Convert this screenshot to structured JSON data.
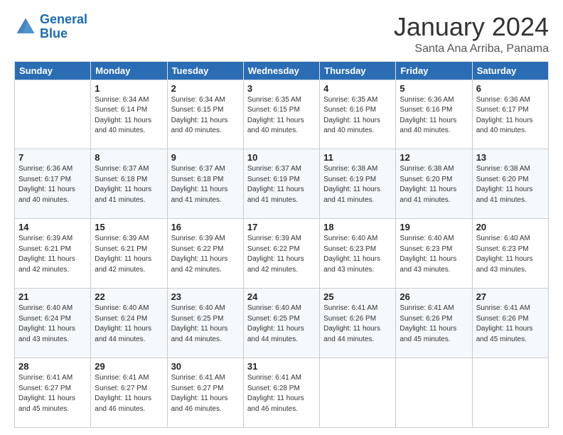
{
  "logo": {
    "line1": "General",
    "line2": "Blue"
  },
  "title": "January 2024",
  "subtitle": "Santa Ana Arriba, Panama",
  "weekdays": [
    "Sunday",
    "Monday",
    "Tuesday",
    "Wednesday",
    "Thursday",
    "Friday",
    "Saturday"
  ],
  "weeks": [
    [
      {
        "day": "",
        "sunrise": "",
        "sunset": "",
        "daylight": ""
      },
      {
        "day": "1",
        "sunrise": "Sunrise: 6:34 AM",
        "sunset": "Sunset: 6:14 PM",
        "daylight": "Daylight: 11 hours and 40 minutes."
      },
      {
        "day": "2",
        "sunrise": "Sunrise: 6:34 AM",
        "sunset": "Sunset: 6:15 PM",
        "daylight": "Daylight: 11 hours and 40 minutes."
      },
      {
        "day": "3",
        "sunrise": "Sunrise: 6:35 AM",
        "sunset": "Sunset: 6:15 PM",
        "daylight": "Daylight: 11 hours and 40 minutes."
      },
      {
        "day": "4",
        "sunrise": "Sunrise: 6:35 AM",
        "sunset": "Sunset: 6:16 PM",
        "daylight": "Daylight: 11 hours and 40 minutes."
      },
      {
        "day": "5",
        "sunrise": "Sunrise: 6:36 AM",
        "sunset": "Sunset: 6:16 PM",
        "daylight": "Daylight: 11 hours and 40 minutes."
      },
      {
        "day": "6",
        "sunrise": "Sunrise: 6:36 AM",
        "sunset": "Sunset: 6:17 PM",
        "daylight": "Daylight: 11 hours and 40 minutes."
      }
    ],
    [
      {
        "day": "7",
        "sunrise": "Sunrise: 6:36 AM",
        "sunset": "Sunset: 6:17 PM",
        "daylight": "Daylight: 11 hours and 40 minutes."
      },
      {
        "day": "8",
        "sunrise": "Sunrise: 6:37 AM",
        "sunset": "Sunset: 6:18 PM",
        "daylight": "Daylight: 11 hours and 41 minutes."
      },
      {
        "day": "9",
        "sunrise": "Sunrise: 6:37 AM",
        "sunset": "Sunset: 6:18 PM",
        "daylight": "Daylight: 11 hours and 41 minutes."
      },
      {
        "day": "10",
        "sunrise": "Sunrise: 6:37 AM",
        "sunset": "Sunset: 6:19 PM",
        "daylight": "Daylight: 11 hours and 41 minutes."
      },
      {
        "day": "11",
        "sunrise": "Sunrise: 6:38 AM",
        "sunset": "Sunset: 6:19 PM",
        "daylight": "Daylight: 11 hours and 41 minutes."
      },
      {
        "day": "12",
        "sunrise": "Sunrise: 6:38 AM",
        "sunset": "Sunset: 6:20 PM",
        "daylight": "Daylight: 11 hours and 41 minutes."
      },
      {
        "day": "13",
        "sunrise": "Sunrise: 6:38 AM",
        "sunset": "Sunset: 6:20 PM",
        "daylight": "Daylight: 11 hours and 41 minutes."
      }
    ],
    [
      {
        "day": "14",
        "sunrise": "Sunrise: 6:39 AM",
        "sunset": "Sunset: 6:21 PM",
        "daylight": "Daylight: 11 hours and 42 minutes."
      },
      {
        "day": "15",
        "sunrise": "Sunrise: 6:39 AM",
        "sunset": "Sunset: 6:21 PM",
        "daylight": "Daylight: 11 hours and 42 minutes."
      },
      {
        "day": "16",
        "sunrise": "Sunrise: 6:39 AM",
        "sunset": "Sunset: 6:22 PM",
        "daylight": "Daylight: 11 hours and 42 minutes."
      },
      {
        "day": "17",
        "sunrise": "Sunrise: 6:39 AM",
        "sunset": "Sunset: 6:22 PM",
        "daylight": "Daylight: 11 hours and 42 minutes."
      },
      {
        "day": "18",
        "sunrise": "Sunrise: 6:40 AM",
        "sunset": "Sunset: 6:23 PM",
        "daylight": "Daylight: 11 hours and 43 minutes."
      },
      {
        "day": "19",
        "sunrise": "Sunrise: 6:40 AM",
        "sunset": "Sunset: 6:23 PM",
        "daylight": "Daylight: 11 hours and 43 minutes."
      },
      {
        "day": "20",
        "sunrise": "Sunrise: 6:40 AM",
        "sunset": "Sunset: 6:23 PM",
        "daylight": "Daylight: 11 hours and 43 minutes."
      }
    ],
    [
      {
        "day": "21",
        "sunrise": "Sunrise: 6:40 AM",
        "sunset": "Sunset: 6:24 PM",
        "daylight": "Daylight: 11 hours and 43 minutes."
      },
      {
        "day": "22",
        "sunrise": "Sunrise: 6:40 AM",
        "sunset": "Sunset: 6:24 PM",
        "daylight": "Daylight: 11 hours and 44 minutes."
      },
      {
        "day": "23",
        "sunrise": "Sunrise: 6:40 AM",
        "sunset": "Sunset: 6:25 PM",
        "daylight": "Daylight: 11 hours and 44 minutes."
      },
      {
        "day": "24",
        "sunrise": "Sunrise: 6:40 AM",
        "sunset": "Sunset: 6:25 PM",
        "daylight": "Daylight: 11 hours and 44 minutes."
      },
      {
        "day": "25",
        "sunrise": "Sunrise: 6:41 AM",
        "sunset": "Sunset: 6:26 PM",
        "daylight": "Daylight: 11 hours and 44 minutes."
      },
      {
        "day": "26",
        "sunrise": "Sunrise: 6:41 AM",
        "sunset": "Sunset: 6:26 PM",
        "daylight": "Daylight: 11 hours and 45 minutes."
      },
      {
        "day": "27",
        "sunrise": "Sunrise: 6:41 AM",
        "sunset": "Sunset: 6:26 PM",
        "daylight": "Daylight: 11 hours and 45 minutes."
      }
    ],
    [
      {
        "day": "28",
        "sunrise": "Sunrise: 6:41 AM",
        "sunset": "Sunset: 6:27 PM",
        "daylight": "Daylight: 11 hours and 45 minutes."
      },
      {
        "day": "29",
        "sunrise": "Sunrise: 6:41 AM",
        "sunset": "Sunset: 6:27 PM",
        "daylight": "Daylight: 11 hours and 46 minutes."
      },
      {
        "day": "30",
        "sunrise": "Sunrise: 6:41 AM",
        "sunset": "Sunset: 6:27 PM",
        "daylight": "Daylight: 11 hours and 46 minutes."
      },
      {
        "day": "31",
        "sunrise": "Sunrise: 6:41 AM",
        "sunset": "Sunset: 6:28 PM",
        "daylight": "Daylight: 11 hours and 46 minutes."
      },
      {
        "day": "",
        "sunrise": "",
        "sunset": "",
        "daylight": ""
      },
      {
        "day": "",
        "sunrise": "",
        "sunset": "",
        "daylight": ""
      },
      {
        "day": "",
        "sunrise": "",
        "sunset": "",
        "daylight": ""
      }
    ]
  ]
}
